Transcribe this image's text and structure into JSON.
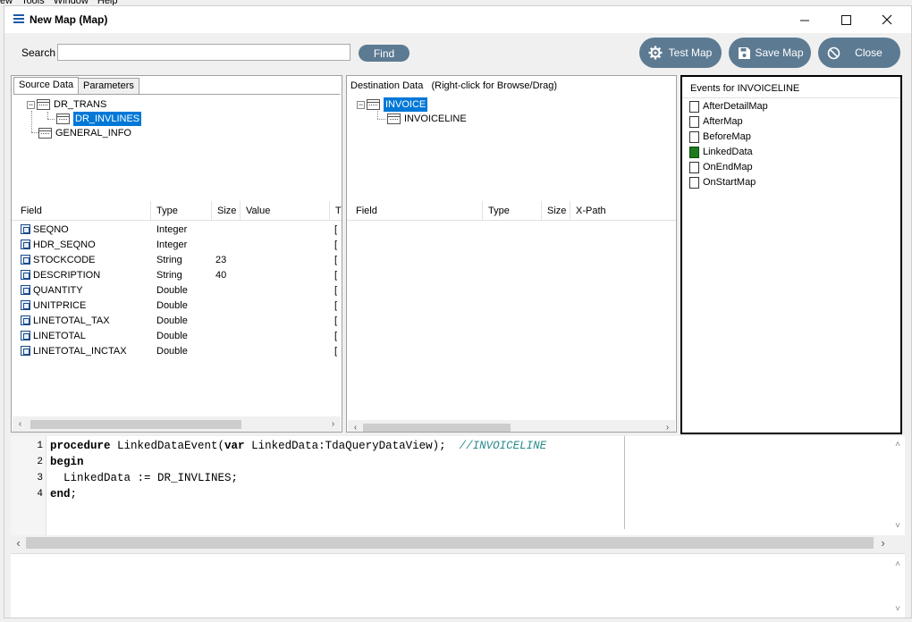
{
  "background_menu": [
    "ew",
    "Tools",
    "Window",
    "Help"
  ],
  "window": {
    "title": "New Map (Map)",
    "controls": {
      "minimize": "—",
      "maximize": "☐",
      "close": "✕"
    }
  },
  "toolbar": {
    "search_label": "Search",
    "search_value": "",
    "find_label": "Find",
    "test_map_label": "Test Map",
    "save_map_label": "Save Map",
    "close_label": "Close"
  },
  "source": {
    "tabs": [
      "Source Data",
      "Parameters"
    ],
    "active_tab": "Source Data",
    "tree": [
      {
        "label": "DR_TRANS",
        "expander": "−"
      },
      {
        "label": "DR_INVLINES",
        "selected": true
      },
      {
        "label": "GENERAL_INFO"
      }
    ],
    "grid": {
      "columns": [
        "Field",
        "Type",
        "Size",
        "Value",
        "T"
      ],
      "rows": [
        {
          "field": "SEQNO",
          "type": "Integer",
          "size": "",
          "extra": "["
        },
        {
          "field": "HDR_SEQNO",
          "type": "Integer",
          "size": "",
          "extra": "["
        },
        {
          "field": "STOCKCODE",
          "type": "String",
          "size": "23",
          "extra": "["
        },
        {
          "field": "DESCRIPTION",
          "type": "String",
          "size": "40",
          "extra": "["
        },
        {
          "field": "QUANTITY",
          "type": "Double",
          "size": "",
          "extra": "["
        },
        {
          "field": "UNITPRICE",
          "type": "Double",
          "size": "",
          "extra": "["
        },
        {
          "field": "LINETOTAL_TAX",
          "type": "Double",
          "size": "",
          "extra": "["
        },
        {
          "field": "LINETOTAL",
          "type": "Double",
          "size": "",
          "extra": "["
        },
        {
          "field": "LINETOTAL_INCTAX",
          "type": "Double",
          "size": "",
          "extra": "["
        }
      ]
    }
  },
  "destination": {
    "header": "Destination Data   (Right-click for Browse/Drag)",
    "tree": [
      {
        "label": "INVOICE",
        "expander": "−",
        "selected": true
      },
      {
        "label": "INVOICELINE"
      }
    ],
    "grid": {
      "columns": [
        "Field",
        "Type",
        "Size",
        "X-Path"
      ],
      "rows": []
    }
  },
  "events": {
    "title": "Events for INVOICELINE",
    "items": [
      {
        "label": "AfterDetailMap",
        "active": false
      },
      {
        "label": "AfterMap",
        "active": false
      },
      {
        "label": "BeforeMap",
        "active": false
      },
      {
        "label": "LinkedData",
        "active": true
      },
      {
        "label": "OnEndMap",
        "active": false
      },
      {
        "label": "OnStartMap",
        "active": false
      }
    ]
  },
  "editor": {
    "lines": [
      {
        "num": "1",
        "parts": [
          {
            "text": "procedure",
            "cls": "kw"
          },
          {
            "text": " LinkedDataEvent(",
            "cls": ""
          },
          {
            "text": "var",
            "cls": "kw"
          },
          {
            "text": " LinkedData:TdaQueryDataView);  ",
            "cls": ""
          },
          {
            "text": "//INVOICELINE",
            "cls": "cm"
          }
        ]
      },
      {
        "num": "2",
        "parts": [
          {
            "text": "begin",
            "cls": "kw"
          }
        ]
      },
      {
        "num": "3",
        "parts": [
          {
            "text": "  LinkedData := DR_INVLINES;",
            "cls": ""
          }
        ]
      },
      {
        "num": "4",
        "parts": [
          {
            "text": "end",
            "cls": "kw"
          },
          {
            "text": ";",
            "cls": ""
          }
        ]
      }
    ]
  },
  "output": {
    "text": ""
  }
}
